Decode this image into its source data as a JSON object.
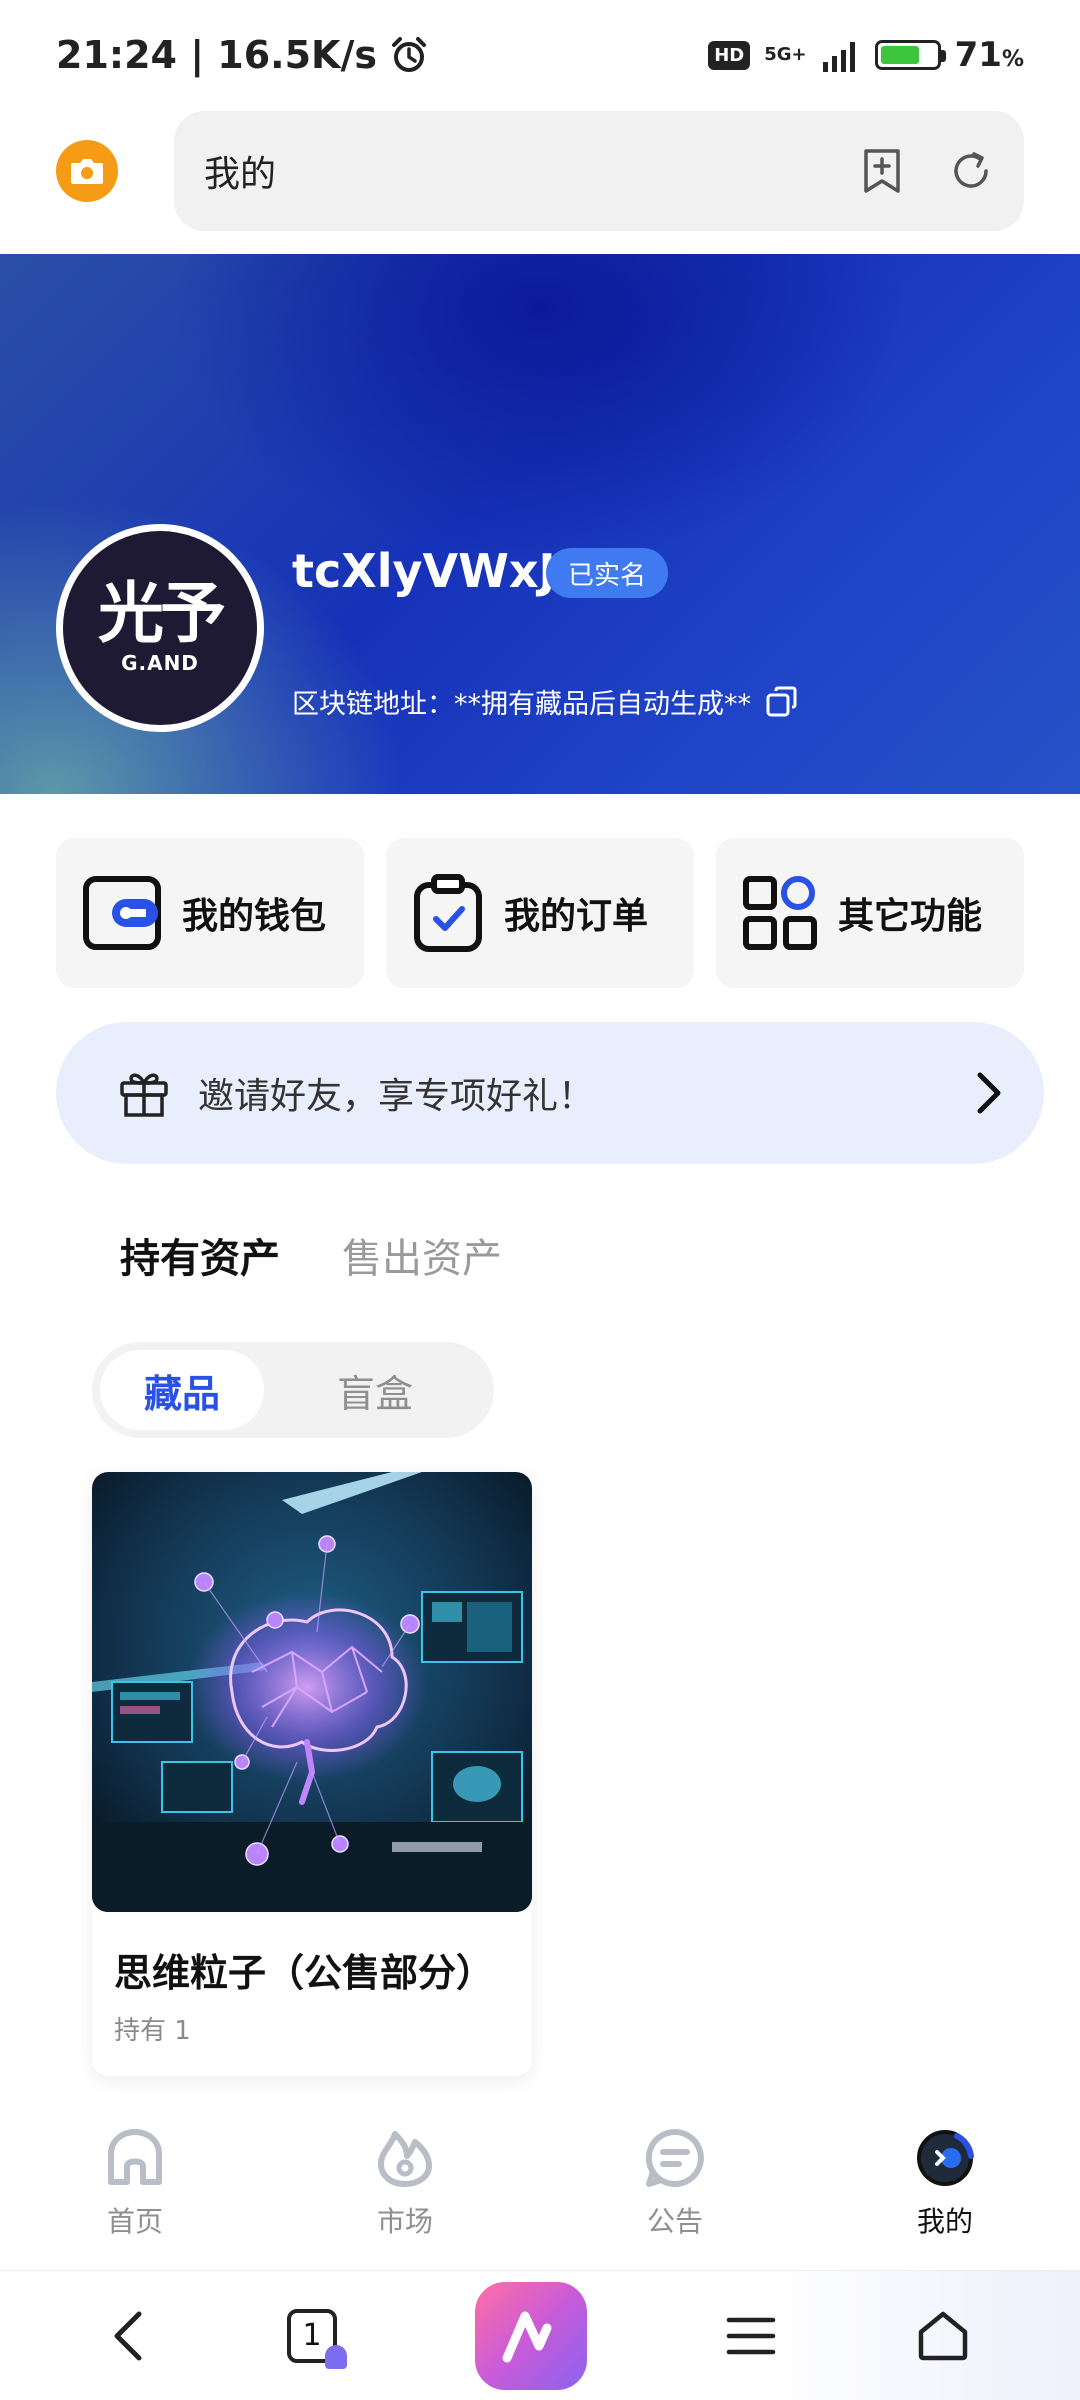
{
  "status_bar": {
    "time_speed": "21:24 | 16.5K/s",
    "hd_badge": "HD",
    "network": "5G+",
    "battery_level": 0.71,
    "battery_value": "71",
    "battery_unit": "%"
  },
  "browser": {
    "address_text": "我的",
    "tab_count": "1",
    "icons": {
      "camera": "camera-icon",
      "bookmark_add": "bookmark-add-icon",
      "refresh": "refresh-icon",
      "back": "back-icon",
      "menu": "menu-icon",
      "home": "home-icon"
    }
  },
  "profile": {
    "avatar_main": "光予",
    "avatar_sub": "G.AND",
    "username": "tcXlyVWxJg",
    "verified_label": "已实名",
    "chain_address": "区块链地址：**拥有藏品后自动生成**"
  },
  "actions": [
    {
      "label": "我的钱包",
      "icon": "wallet-icon"
    },
    {
      "label": "我的订单",
      "icon": "order-clipboard-icon"
    },
    {
      "label": "其它功能",
      "icon": "apps-grid-icon"
    }
  ],
  "invite": {
    "text": "邀请好友，享专项好礼！",
    "icon": "gift-icon"
  },
  "asset_tabs": {
    "held": "持有资产",
    "sold": "售出资产",
    "active": "held"
  },
  "segment": {
    "collectibles": "藏品",
    "blind_box": "盲盒",
    "active": "collectibles"
  },
  "collection": [
    {
      "title": "思维粒子（公售部分）",
      "subtitle": "持有 1"
    }
  ],
  "app_nav": [
    {
      "label": "首页",
      "icon": "home-icon"
    },
    {
      "label": "市场",
      "icon": "market-icon"
    },
    {
      "label": "公告",
      "icon": "announcement-icon"
    },
    {
      "label": "我的",
      "icon": "profile-icon"
    }
  ],
  "colors": {
    "accent_blue": "#2a51e6",
    "camera_orange": "#f59b16",
    "badge_blue": "#3f7af0",
    "invite_bg": "#e9eefc"
  }
}
